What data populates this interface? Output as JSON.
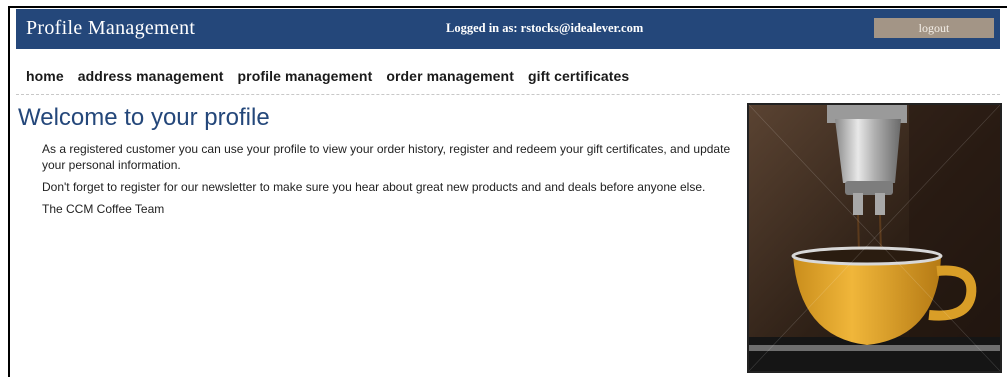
{
  "header": {
    "title": "Profile Management",
    "logged_in_text": "Logged in as: rstocks@idealever.com",
    "logout_label": "logout"
  },
  "nav": {
    "items": [
      {
        "label": "home"
      },
      {
        "label": "address management"
      },
      {
        "label": "profile management"
      },
      {
        "label": "order management"
      },
      {
        "label": "gift certificates"
      }
    ]
  },
  "main": {
    "title": "Welcome to your profile",
    "paragraphs": [
      "As a registered customer you can use your profile to view your order history, register and redeem your gift certificates, and update your personal information.",
      "Don't forget to register for our newsletter to make sure you hear about great new products and and deals before anyone else.",
      "The CCM Coffee Team"
    ]
  },
  "colors": {
    "header_bg": "#24477a",
    "logout_bg": "#a39586",
    "title_color": "#24477a",
    "cup": "#e6a92c"
  }
}
